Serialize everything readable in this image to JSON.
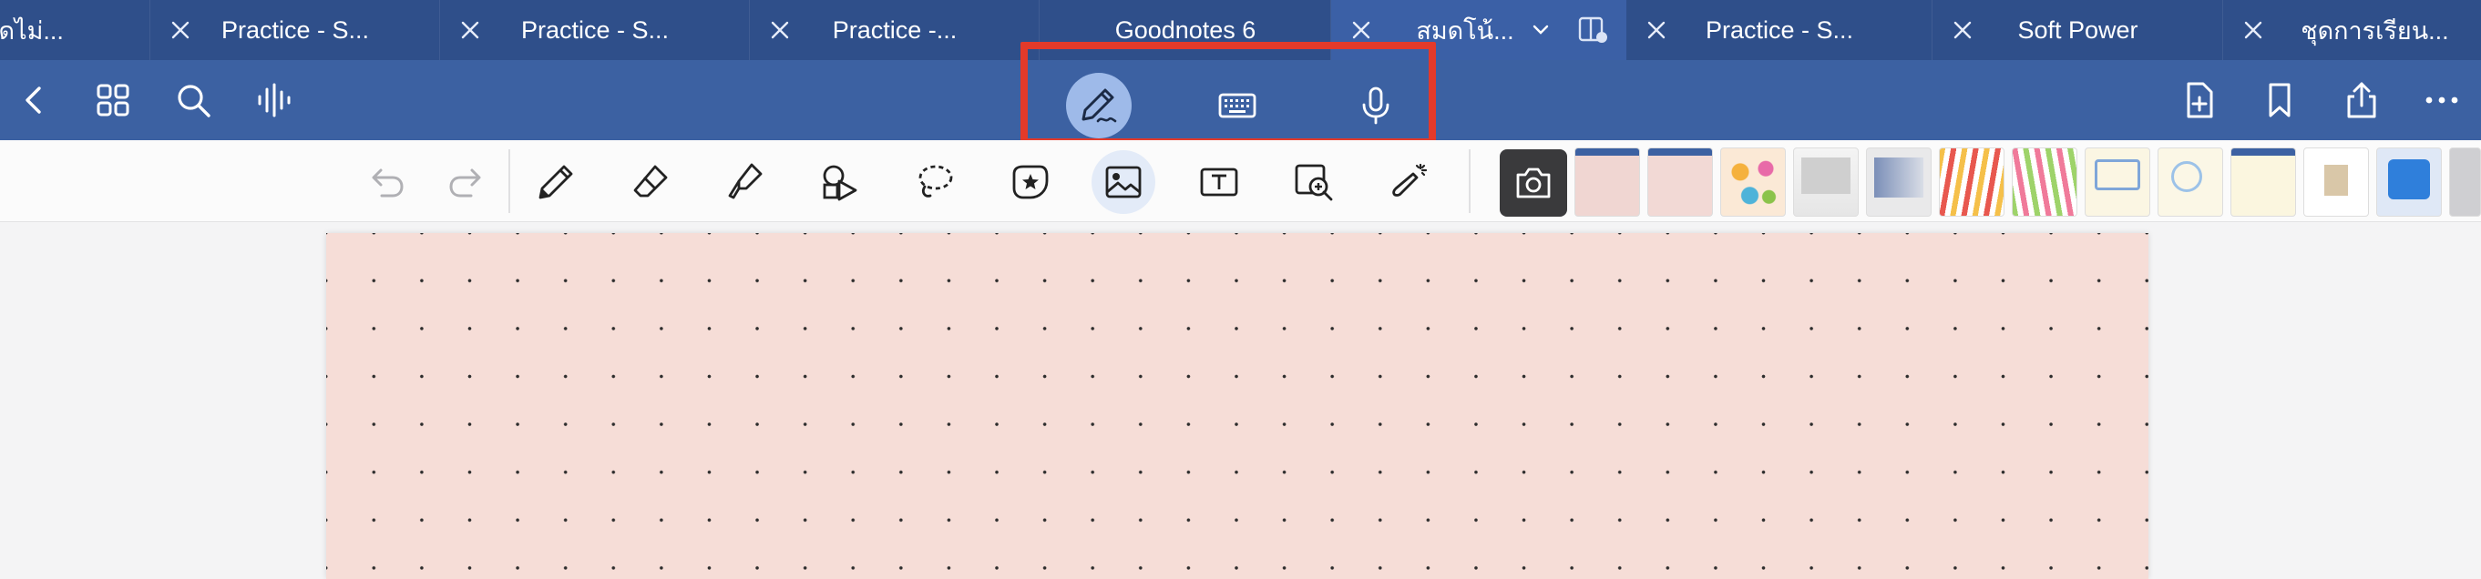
{
  "tabs": [
    {
      "title": "นัดไม่...",
      "active": false
    },
    {
      "title": "Practice - S...",
      "active": false
    },
    {
      "title": "Practice - S...",
      "active": false
    },
    {
      "title": "Practice -...",
      "active": false
    },
    {
      "title": "Goodnotes 6",
      "active": false
    },
    {
      "title": "สมดโน้...",
      "active": true
    },
    {
      "title": "Practice - S...",
      "active": false
    },
    {
      "title": "Soft Power",
      "active": false
    },
    {
      "title": "ชุดการเรียน...",
      "active": false
    }
  ],
  "toolbar": {
    "left_icons": [
      "back-icon",
      "grid-icon",
      "search-icon",
      "audio-waveform-icon"
    ],
    "modes": [
      {
        "name": "handwriting-mode",
        "icon": "pen-icon",
        "active": true
      },
      {
        "name": "keyboard-mode",
        "icon": "keyboard-icon",
        "active": false
      },
      {
        "name": "voice-mode",
        "icon": "microphone-icon",
        "active": false
      }
    ],
    "right_icons": [
      "add-page-icon",
      "bookmark-icon",
      "share-icon",
      "more-icon"
    ]
  },
  "tools": {
    "items": [
      "undo-icon",
      "redo-icon",
      "pen-tool-icon",
      "eraser-icon",
      "highlighter-icon",
      "shapes-icon",
      "lasso-icon",
      "sticker-icon",
      "image-icon",
      "text-box-icon",
      "zoom-window-icon",
      "laser-pointer-icon"
    ],
    "selected": "image-icon"
  },
  "colors": {
    "tabbar": "#2f4f8a",
    "toolbar": "#3c61a2",
    "highlight": "#e33a2a",
    "page": "#f6ddd7"
  }
}
